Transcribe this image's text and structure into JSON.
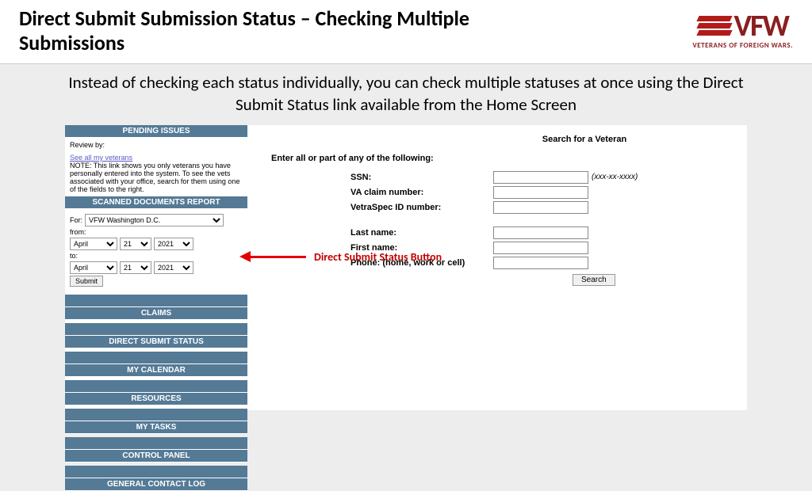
{
  "header": {
    "title": "Direct Submit Submission Status – Checking Multiple Submissions",
    "logo_letters": "VFW",
    "logo_sub": "VETERANS OF FOREIGN WARS."
  },
  "subtitle": "Instead of checking each status individually, you can check multiple statuses at once using the Direct Submit Status link available from the Home Screen",
  "sidebar": {
    "pending_header": "PENDING ISSUES",
    "review_by": "Review by:",
    "see_all_link": "See all my veterans",
    "note": "NOTE: This link shows you only veterans you have personally entered into the system. To see the vets associated with your office, search for them using one of the fields to the right.",
    "scanned_header": "SCANNED DOCUMENTS REPORT",
    "for_label": "For:",
    "org_option": "VFW Washington D.C.",
    "from_label": "from:",
    "to_label": "to:",
    "month_option": "April",
    "day_option": "21",
    "year_option": "2021",
    "submit_btn": "Submit",
    "nav": [
      "CLAIMS",
      "DIRECT SUBMIT STATUS",
      "MY CALENDAR",
      "RESOURCES",
      "MY TASKS",
      "CONTROL PANEL",
      "GENERAL CONTACT LOG"
    ]
  },
  "search": {
    "title": "Search for a Veteran",
    "prompt": "Enter all or part of any of the following:",
    "fields": {
      "ssn": "SSN:",
      "ssn_hint": "(xxx-xx-xxxx)",
      "va_claim": "VA claim number:",
      "vetraspec": "VetraSpec ID number:",
      "last_name": "Last name:",
      "first_name": "First name:",
      "phone": "Phone: (home, work or cell)"
    },
    "search_btn": "Search"
  },
  "callout": "Direct Submit Status Button"
}
